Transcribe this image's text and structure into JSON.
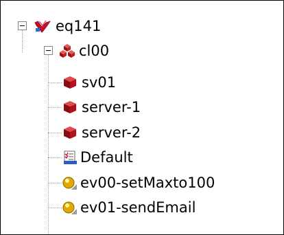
{
  "tree": {
    "root": {
      "label": "eq141",
      "icon": "equipment-icon",
      "expanded": true,
      "children": [
        {
          "label": "cl00",
          "icon": "cluster-icon",
          "expanded": true,
          "children": [
            {
              "label": "sv01",
              "icon": "server-cube-icon"
            },
            {
              "label": "server-1",
              "icon": "server-cube-icon"
            },
            {
              "label": "server-2",
              "icon": "server-cube-icon"
            },
            {
              "label": "Default",
              "icon": "checklist-icon"
            },
            {
              "label": "ev00-setMaxto100",
              "icon": "event-icon"
            },
            {
              "label": "ev01-sendEmail",
              "icon": "event-icon"
            }
          ]
        }
      ]
    }
  },
  "colors": {
    "accent_red": "#c8102e",
    "cube_red": "#b5101e",
    "event_gold": "#e0a800"
  }
}
